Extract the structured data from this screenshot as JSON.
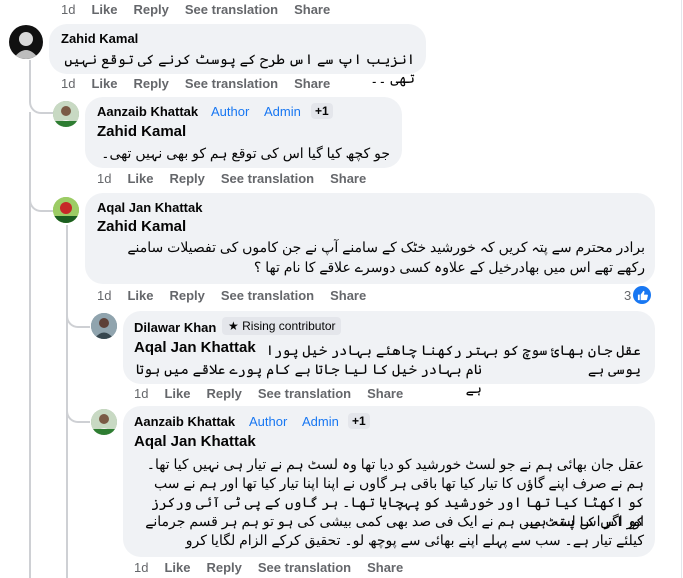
{
  "top_actions": {
    "time": "1d",
    "like": "Like",
    "reply": "Reply",
    "translate": "See translation",
    "share": "Share"
  },
  "comments": [
    {
      "author": "Zahid Kamal",
      "text": "انزیب اپ سے اس طرح کے پوسٹ کرنے کی توقع نہیں تھی ۔۔",
      "actions": {
        "time": "1d",
        "like": "Like",
        "reply": "Reply",
        "translate": "See translation",
        "share": "Share"
      }
    },
    {
      "author": "Aanzaib Khattak",
      "badge_author": "Author",
      "badge_admin": "Admin",
      "badge_more": "+1",
      "mention": "Zahid Kamal",
      "text": "جو کچھ کیا گیا اس کی توقع ہم کو بھی نہیں تھی۔",
      "actions": {
        "time": "1d",
        "like": "Like",
        "reply": "Reply",
        "translate": "See translation",
        "share": "Share"
      }
    },
    {
      "author": "Aqal Jan Khattak",
      "mention": "Zahid Kamal",
      "text_lines": [
        "برادر محترم سے پتہ کریں کہ خورشید خٹک کے سامنے آپ نے جن کاموں کی تفصیلات سامنے",
        "رکھے تھے اس میں بھادرخیل کے علاوہ کسی دوسرے علاقے کا نام تھا ؟"
      ],
      "reaction_count": "3",
      "actions": {
        "time": "1d",
        "like": "Like",
        "reply": "Reply",
        "translate": "See translation",
        "share": "Share"
      }
    },
    {
      "author": "Dilawar Khan",
      "badge_rising": "Rising contributor",
      "mention": "Aqal Jan Khattak",
      "text_lines": [
        "عقل جان بھائ سوچ کو بہتر رکھنا چاھئے بہادر خیل پورا یوسی ہے",
        "نام بہادر خیل کا لیا جاتا ہے کام پورے علاقے میں ہوتا ہے"
      ],
      "actions": {
        "time": "1d",
        "like": "Like",
        "reply": "Reply",
        "translate": "See translation",
        "share": "Share"
      }
    },
    {
      "author": "Aanzaib Khattak",
      "badge_author": "Author",
      "badge_admin": "Admin",
      "badge_more": "+1",
      "mention": "Aqal Jan Khattak",
      "text_lines": [
        "عقل جان بھائی ہم نے جو لسٹ خورشید کو دیا تھا وہ لسٹ ہم نے تیار ہی نہیں کیا تھا۔",
        "ہم نے صرف اپنے گاؤں کا تیار کیا تھا باقی ہر گاوں نے اپنا اپنا تیار کیا تھا اور ہم نے سب",
        "کو اکھٹا کیا تھا اور خورشید کو پہچایا تھا۔ ہر گاوں کے پی ٹی آئی ورکرز کو اس کا پتہ ہے۔",
        "اور اگر اس لسٹ میں ہم نے ایک فی صد بھی کمی بیشی کی ہو تو ہم ہر قسم جرمانے",
        "کیلئے تیار ہے۔ سب سے پہلے اپنے بھائی سے پوچھ لو۔ تحقیق کرکے الزام لگایا کرو"
      ],
      "actions": {
        "time": "1d",
        "like": "Like",
        "reply": "Reply",
        "translate": "See translation",
        "share": "Share"
      }
    }
  ]
}
